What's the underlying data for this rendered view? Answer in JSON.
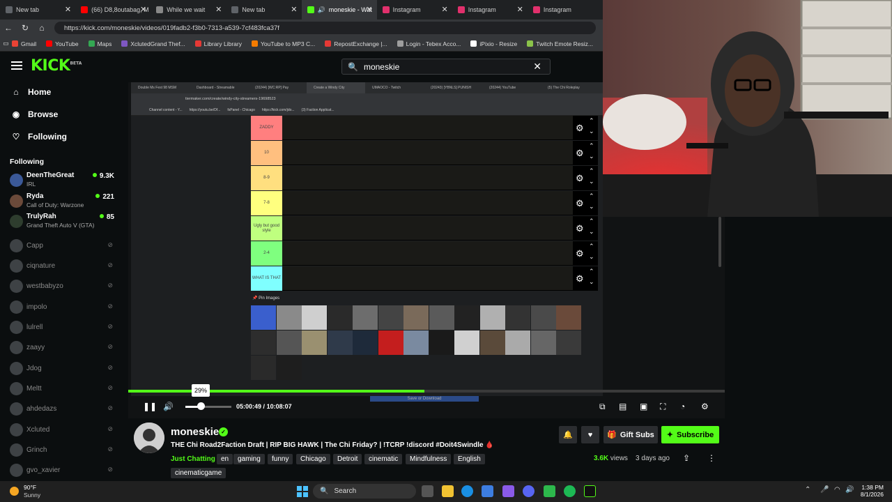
{
  "browser": {
    "tabs": [
      {
        "title": "New tab",
        "color": "#5f6368",
        "active": false
      },
      {
        "title": "(66) D8,8outabag, M",
        "color": "#ff0000",
        "active": false
      },
      {
        "title": "While we wait",
        "color": "#888888",
        "active": false
      },
      {
        "title": "New tab",
        "color": "#5f6368",
        "active": false
      },
      {
        "title": "moneskie - Wat",
        "color": "#53fc18",
        "active": true
      },
      {
        "title": "Instagram",
        "color": "#e1306c",
        "active": false
      },
      {
        "title": "Instagram",
        "color": "#e1306c",
        "active": false
      },
      {
        "title": "Instagram",
        "color": "#e1306c",
        "active": false
      }
    ],
    "url": "https://kick.com/moneskie/videos/019fadb2-f3b0-7313-a539-7cf483fca37f",
    "bookmarks": [
      {
        "label": "Gmail",
        "color": "#ea4335"
      },
      {
        "label": "YouTube",
        "color": "#ff0000"
      },
      {
        "label": "Maps",
        "color": "#34a853"
      },
      {
        "label": "XclutedGrand Thef...",
        "color": "#7e57c2"
      },
      {
        "label": "Library Library",
        "color": "#e53935"
      },
      {
        "label": "YouTube to MP3 C...",
        "color": "#f57c00"
      },
      {
        "label": "RepostExchange |...",
        "color": "#e53935"
      },
      {
        "label": "Login - Tebex Acco...",
        "color": "#9e9e9e"
      },
      {
        "label": "iPixio - Resize",
        "color": "#ffffff"
      },
      {
        "label": "Twitch Emote Resiz...",
        "color": "#8bc34a"
      }
    ]
  },
  "kick": {
    "logo": "KICK",
    "logo_badge": "BETA",
    "search_value": "moneskie"
  },
  "sidebar": {
    "nav": [
      {
        "label": "Home",
        "icon": "home-icon"
      },
      {
        "label": "Browse",
        "icon": "compass-icon"
      },
      {
        "label": "Following",
        "icon": "heart-icon"
      }
    ],
    "following_heading": "Following",
    "live": [
      {
        "name": "DeenTheGreat",
        "category": "IRL",
        "viewers": "9.3K"
      },
      {
        "name": "Ryda",
        "category": "Call of Duty: Warzone",
        "viewers": "221"
      },
      {
        "name": "TrulyRah",
        "category": "Grand Theft Auto V (GTA)",
        "viewers": "85"
      }
    ],
    "offline": [
      "Capp",
      "ciqnature",
      "westbabyzo",
      "impolo",
      "lulrell",
      "zaayy",
      "Jdog",
      "Meltt",
      "ahdedazs",
      "Xcluted",
      "Grinch",
      "gvo_xavier"
    ]
  },
  "inner_screen": {
    "tabs": [
      "Double Ms Fest 98 MSM",
      "Dashboard - Streamable",
      "(20244) [WC:RP] Pay",
      "Create a Windy City",
      "UMAOCO - Twitch",
      "(20243) [YBNLS] PUNISH",
      "(20244) YouTube",
      "(5) The Chi Roleplay"
    ],
    "url": "tiermaker.com/create/windy-city-streamers-19698523",
    "bookmarks": [
      "Channel content - Y...",
      "https://youtu.be/Df...",
      "fsPanel - Chicago",
      "https://kick.com/jdo...",
      "(3) Faction Applicat..."
    ],
    "tiers": [
      {
        "label": "ZADDY",
        "color": "#ff7f7f"
      },
      {
        "label": "10",
        "color": "#ffbf7f"
      },
      {
        "label": "8-9",
        "color": "#ffdf7f"
      },
      {
        "label": "7-8",
        "color": "#ffff7f"
      },
      {
        "label": "Ugly but good style",
        "color": "#bfff7f"
      },
      {
        "label": "2-4",
        "color": "#7fff7f"
      },
      {
        "label": "WHAT IS THAT",
        "color": "#7fffff"
      }
    ],
    "pin_label": "Pin Images",
    "save_label": "Save or Download"
  },
  "player": {
    "progress": 0.497,
    "volume_percent": "29%",
    "volume": 0.29,
    "time_current": "05:00:49",
    "time_separator": "/",
    "time_total": "10:08:07"
  },
  "stream_info": {
    "channel": "moneskie",
    "title": "THE Chi Road2Faction Draft  | RIP BIG HAWK | The Chi Friday? | !TCRP !discord #Doit4Swindle 🩸",
    "category": "Just Chatting",
    "tags": [
      "en",
      "gaming",
      "funny",
      "Chicago",
      "Detroit",
      "cinematic",
      "Mindfulness",
      "English",
      "cinematicgame"
    ],
    "gift_label": "Gift Subs",
    "subscribe_label": "Subscribe",
    "views_count": "3.6K",
    "views_word": "views",
    "age": "3 days ago"
  },
  "taskbar": {
    "temp": "90°F",
    "condition": "Sunny",
    "search_label": "Search",
    "time": "1:38 PM",
    "date": "8/1/2026"
  }
}
